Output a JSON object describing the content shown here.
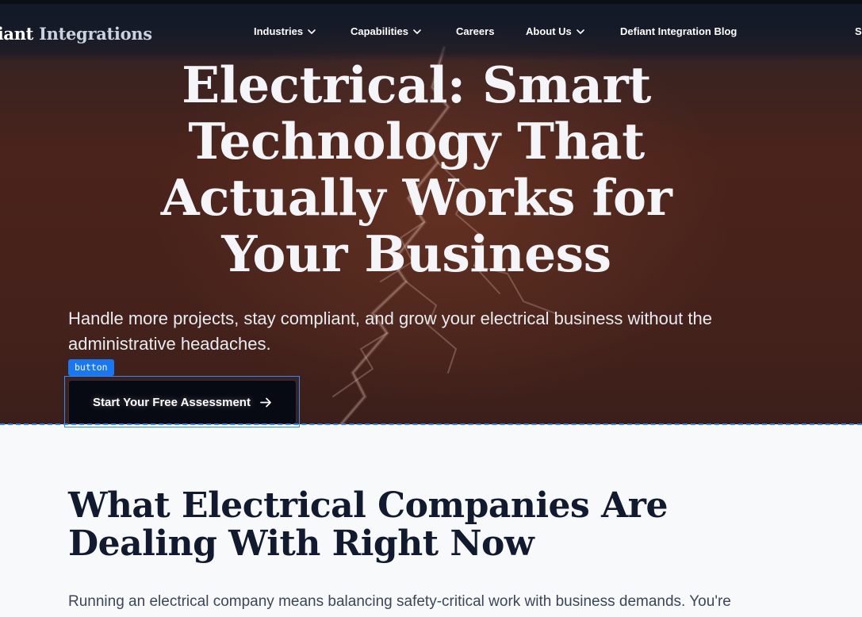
{
  "nav": {
    "logo_part1": "fiant",
    "logo_part2": "Integrations",
    "items": [
      {
        "label": "Industries",
        "has_dropdown": true
      },
      {
        "label": "Capabilities",
        "has_dropdown": true
      },
      {
        "label": "Careers",
        "has_dropdown": false
      },
      {
        "label": "About Us",
        "has_dropdown": true
      },
      {
        "label": "Defiant Integration Blog",
        "has_dropdown": false
      }
    ],
    "cut_item": "S"
  },
  "hero": {
    "title": "Electrical: Smart Technology That Actually Works for Your Business",
    "subtitle": "Handle more projects, stay compliant, and grow your electrical business without the administrative headaches.",
    "cta_label": "Start Your Free Assessment",
    "inspector_label": "button"
  },
  "section": {
    "title": "What Electrical Companies Are Dealing With Right Now",
    "body": "Running an electrical company means balancing safety-critical work with business demands. You're"
  },
  "colors": {
    "nav_bg": "#111826",
    "hero_overlay": "#44221b",
    "cta_bg": "#070a12",
    "inspector_accent": "#1877f2",
    "section_title": "#111a2e",
    "page_bg": "#f8f9fb"
  },
  "icons": {
    "dropdown": "chevron-down-icon",
    "cta": "arrow-right-icon"
  }
}
